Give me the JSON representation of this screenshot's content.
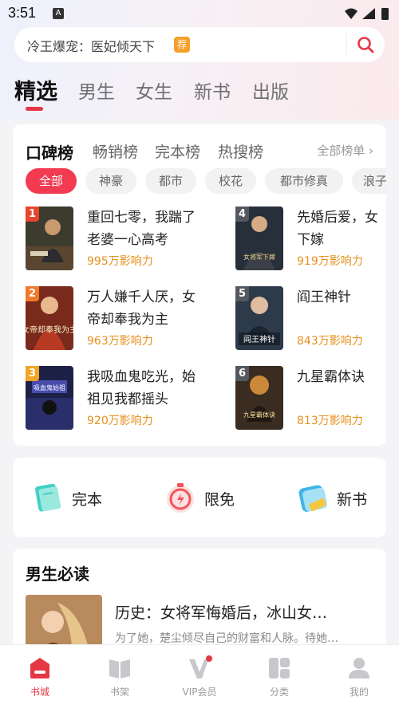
{
  "status_bar": {
    "time": "3:51",
    "app_badge": "A"
  },
  "search": {
    "text": "冷王爆宠：医妃倾天下",
    "tag": "荐"
  },
  "main_tabs": [
    {
      "label": "精选",
      "active": true
    },
    {
      "label": "男生"
    },
    {
      "label": "女生"
    },
    {
      "label": "新书"
    },
    {
      "label": "出版"
    }
  ],
  "ranking": {
    "tabs": [
      {
        "label": "口碑榜",
        "active": true
      },
      {
        "label": "畅销榜"
      },
      {
        "label": "完本榜"
      },
      {
        "label": "热搜榜"
      }
    ],
    "all_label": "全部榜单 ›",
    "chips": [
      {
        "label": "全部",
        "active": true
      },
      {
        "label": "神豪"
      },
      {
        "label": "都市"
      },
      {
        "label": "校花"
      },
      {
        "label": "都市修真"
      },
      {
        "label": "浪子"
      }
    ],
    "books": [
      {
        "rank": "1",
        "title": "重回七零，我踹了老婆一心高考",
        "heat": "995万影响力",
        "rank_color": "#e8452f"
      },
      {
        "rank": "2",
        "title": "万人嫌千人厌，女帝却奉我为主",
        "heat": "963万影响力",
        "rank_color": "#f07a2c"
      },
      {
        "rank": "3",
        "title": "我吸血鬼吃光，始祖见我都摇头",
        "heat": "920万影响力",
        "rank_color": "#f0a526"
      },
      {
        "rank": "4",
        "title": "先婚后爱，女下嫁",
        "heat": "919万影响力",
        "rank_color": "#55595f",
        "cover_text": "女将军下嫁"
      },
      {
        "rank": "5",
        "title": "阎王神针",
        "heat": "843万影响力",
        "rank_color": "#55595f",
        "cover_text": "阎王神针"
      },
      {
        "rank": "6",
        "title": "九星霸体诀",
        "heat": "813万影响力",
        "rank_color": "#55595f",
        "cover_text": "九星霸体诀"
      }
    ],
    "cover_texts": {
      "2": "女帝却奉我为主",
      "3": "吸血鬼始祖"
    }
  },
  "categories": [
    {
      "label": "完本",
      "icon": "book-icon",
      "color": "#3fd1c6"
    },
    {
      "label": "限免",
      "icon": "stopwatch-icon",
      "color": "#f0545a"
    },
    {
      "label": "新书",
      "icon": "new-tag-icon",
      "color": "#3fb6e8"
    }
  ],
  "must_read": {
    "title": "男生必读",
    "book_title": "历史：女将军悔婚后，冰山女…",
    "book_desc": "为了她，楚尘倾尽自己的财富和人脉。待她…"
  },
  "bottom_nav": [
    {
      "label": "书城",
      "icon": "bookstore-icon",
      "active": true
    },
    {
      "label": "书架",
      "icon": "bookshelf-icon"
    },
    {
      "label": "VIP会员",
      "icon": "vip-icon"
    },
    {
      "label": "分类",
      "icon": "category-icon"
    },
    {
      "label": "我的",
      "icon": "profile-icon"
    }
  ],
  "colors": {
    "accent": "#e53844",
    "heat": "#e7901c",
    "chip_active": "#f23a51"
  }
}
